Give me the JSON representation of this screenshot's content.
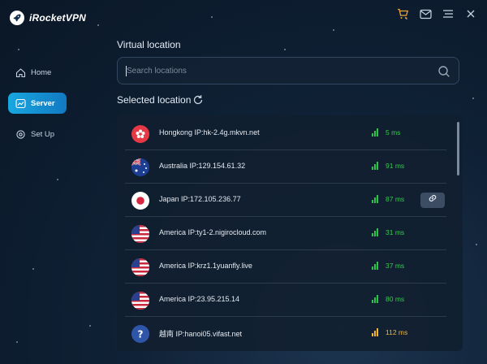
{
  "app": {
    "name": "iRocketVPN"
  },
  "sidebar": {
    "items": [
      {
        "label": "Home",
        "icon": "home-icon",
        "active": false
      },
      {
        "label": "Server",
        "icon": "chart-icon",
        "active": true
      },
      {
        "label": "Set Up",
        "icon": "gear-icon",
        "active": false
      }
    ]
  },
  "main": {
    "virtual_title": "Virtual location",
    "search_placeholder": "Search locations",
    "selected_title": "Selected location"
  },
  "locations": [
    {
      "flag": "hongkong",
      "name": "Hongkong IP:hk-2.4g.mkvn.net",
      "latency": "5 ms",
      "quality": "good"
    },
    {
      "flag": "australia",
      "name": "Australia IP:129.154.61.32",
      "latency": "91 ms",
      "quality": "good"
    },
    {
      "flag": "japan",
      "name": "Japan IP:172.105.236.77",
      "latency": "87 ms",
      "quality": "good",
      "connected": true
    },
    {
      "flag": "usa",
      "name": "America IP:ty1-2.nigirocloud.com",
      "latency": "31 ms",
      "quality": "good"
    },
    {
      "flag": "usa",
      "name": "America IP:krz1.1yuanfly.live",
      "latency": "37 ms",
      "quality": "good"
    },
    {
      "flag": "usa",
      "name": "America IP:23.95.215.14",
      "latency": "80 ms",
      "quality": "good"
    },
    {
      "flag": "unknown",
      "name": "越南 IP:hanoi05.vifast.net",
      "latency": "112 ms",
      "quality": "medium"
    }
  ],
  "colors": {
    "accent": "#18a7e0",
    "latency_good": "#39c752",
    "latency_medium": "#f2b630",
    "cart_icon": "#f0a53a"
  }
}
